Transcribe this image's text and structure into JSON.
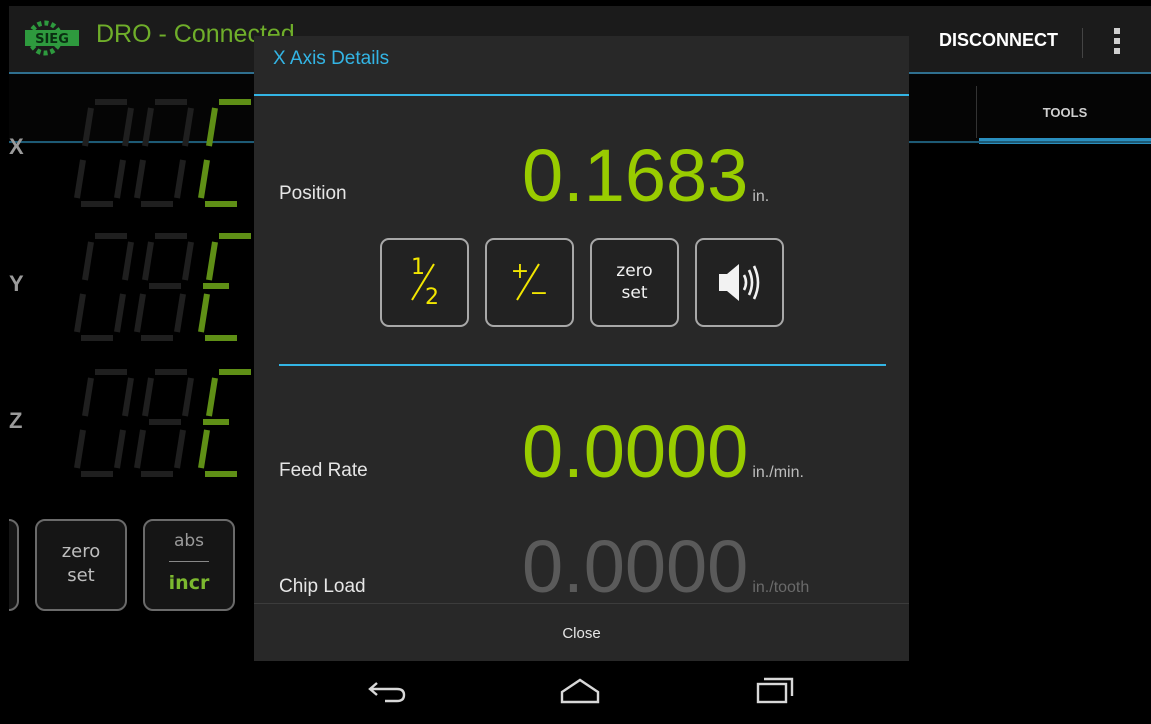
{
  "colors": {
    "accent": "#33b5e5",
    "value_green": "#99cc00",
    "value_dim": "#5a5a5a",
    "brand_green": "#6fae2a",
    "button_yellow": "#f2e600"
  },
  "actionbar": {
    "logo_icon": "sieg-logo-icon",
    "title": "DRO - Connected",
    "disconnect_label": "DISCONNECT",
    "overflow_icon": "overflow-menu-icon"
  },
  "tabs": {
    "tools_label": "TOOLS"
  },
  "axes": {
    "x_label": "X",
    "y_label": "Y",
    "z_label": "Z"
  },
  "bottom_buttons": {
    "zero_set_line1": "zero",
    "zero_set_line2": "set",
    "abs_label": "abs",
    "incr_label": "incr"
  },
  "dialog": {
    "title": "X Axis Details",
    "position_label": "Position",
    "position_value": "0.1683",
    "position_unit": "in.",
    "half_top": "1",
    "half_bottom": "2",
    "plusminus_top": "+",
    "plusminus_bottom": "−",
    "zero_set_line1": "zero",
    "zero_set_line2": "set",
    "speaker_icon": "speaker-icon",
    "feed_rate_label": "Feed Rate",
    "feed_rate_value": "0.0000",
    "feed_rate_unit": "in./min.",
    "chip_load_label": "Chip Load",
    "chip_load_value": "0.0000",
    "chip_load_unit": "in./tooth",
    "close_label": "Close"
  },
  "navbar": {
    "back_icon": "back-icon",
    "home_icon": "home-icon",
    "recents_icon": "recents-icon"
  }
}
